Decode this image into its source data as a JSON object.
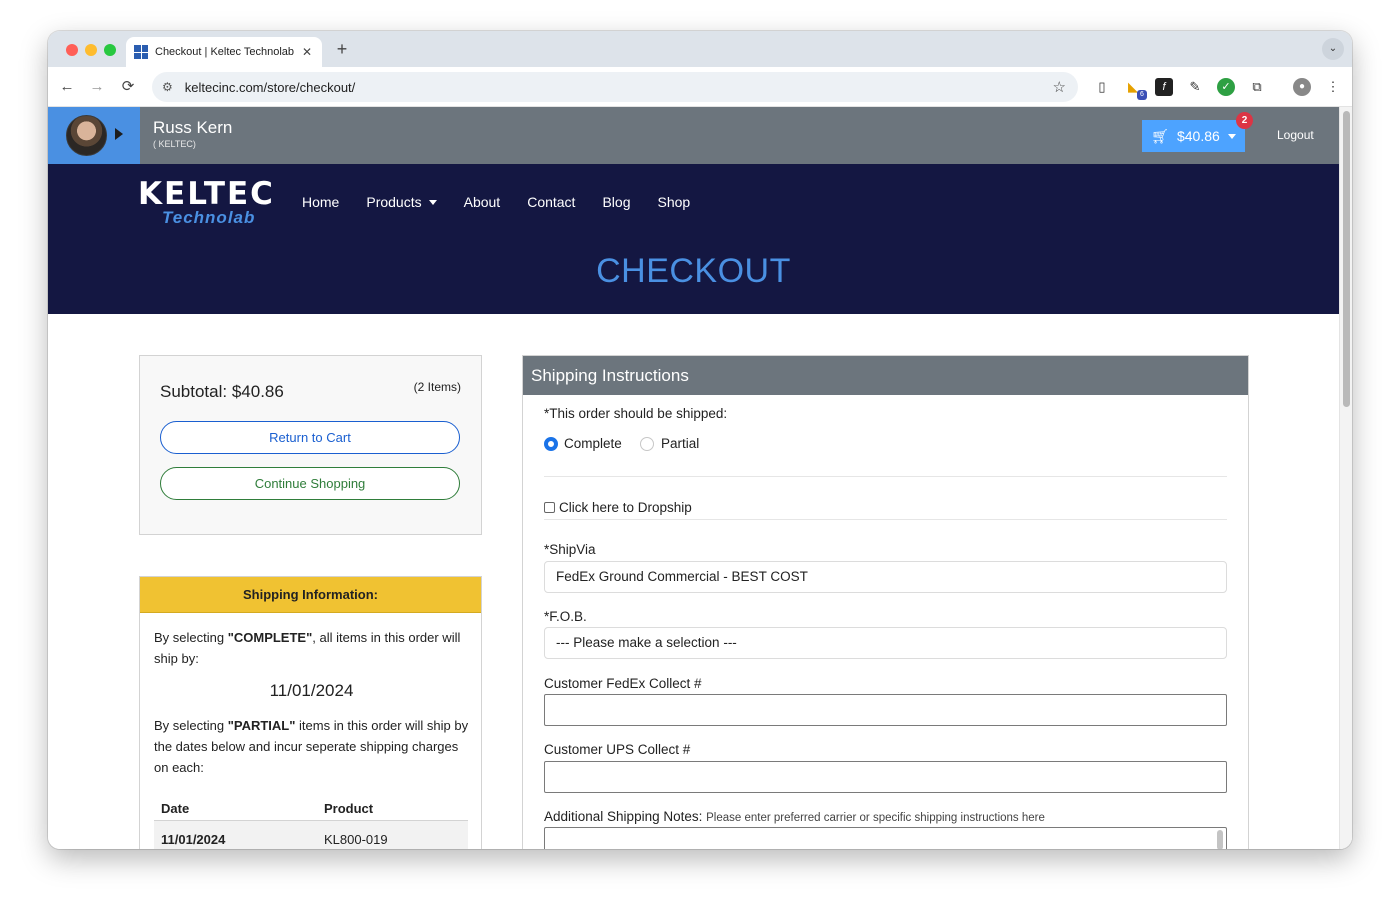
{
  "browser": {
    "tab_title": "Checkout | Keltec Technolab",
    "tab_close": "✕",
    "new_tab": "+",
    "tab_search": "⌄",
    "url": "keltecinc.com/store/checkout/",
    "nav_back": "←",
    "nav_forward": "→",
    "nav_reload": "⟳",
    "extension_badge": "6",
    "menu": "⋮"
  },
  "userbar": {
    "name": "Russ Kern",
    "company": "( KELTEC)",
    "cart_total": "$40.86",
    "cart_count": "2",
    "logout": "Logout"
  },
  "site": {
    "logo_main": "KELTEC",
    "logo_sub": "Technolab",
    "nav": [
      {
        "label": "Home"
      },
      {
        "label": "Products"
      },
      {
        "label": "About"
      },
      {
        "label": "Contact"
      },
      {
        "label": "Blog"
      },
      {
        "label": "Shop"
      }
    ],
    "page_title": "CHECKOUT"
  },
  "summary": {
    "subtotal": "Subtotal: $40.86",
    "items": "(2 Items)",
    "return_cart": "Return to Cart",
    "continue_shopping": "Continue Shopping"
  },
  "shipping_info": {
    "header": "Shipping Information:",
    "complete_pre": "By selecting ",
    "complete_word": "\"COMPLETE\"",
    "complete_post": ", all items in this order will ship by:",
    "ship_date": "11/01/2024",
    "partial_pre": "By selecting ",
    "partial_word": "\"PARTIAL\"",
    "partial_post": " items in this order will ship by the dates below and incur seperate shipping charges on each:",
    "table": {
      "headers": [
        "Date",
        "Product"
      ],
      "rows": [
        {
          "date": "11/01/2024",
          "product": "KL800-019"
        }
      ]
    }
  },
  "instructions": {
    "header": "Shipping Instructions",
    "ship_question": "*This order should be shipped:",
    "radio_complete": "Complete",
    "radio_partial": "Partial",
    "dropship": "Click here to Dropship",
    "shipvia_label": "*ShipVia",
    "shipvia_value": "FedEx Ground Commercial - BEST COST",
    "fob_label": "*F.O.B.",
    "fob_value": "--- Please make a selection ---",
    "fedex_label": "Customer FedEx Collect #",
    "ups_label": "Customer UPS Collect #",
    "notes_label": "Additional Shipping Notes:",
    "notes_hint": "Please enter preferred carrier or specific shipping instructions here"
  },
  "colors": {
    "navy": "#141742",
    "accent_blue": "#4a90e2",
    "header_gray": "#6c757d",
    "yellow": "#f0c232"
  }
}
